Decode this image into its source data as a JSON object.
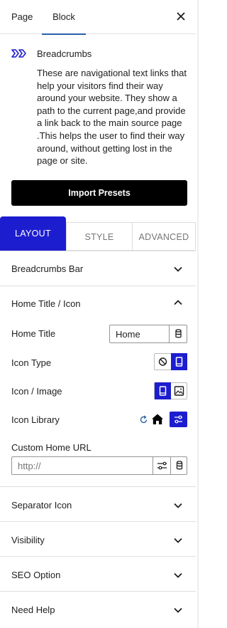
{
  "sidebar_tabs": {
    "page": "Page",
    "block": "Block"
  },
  "block": {
    "name": "Breadcrumbs",
    "description": "These are navigational text links that help your visitors find their way around your website. They show a path to the current page,and provide a link back to the main source page .This helps the user to find their way around, without getting lost in the page or site."
  },
  "import_button": "Import Presets",
  "settings_tabs": {
    "layout": "LAYOUT",
    "style": "STYLE",
    "advanced": "ADVANCED"
  },
  "panels": {
    "breadcrumbs_bar": "Breadcrumbs Bar",
    "home_title_icon": "Home Title / Icon",
    "separator_icon": "Separator Icon",
    "visibility": "Visibility",
    "seo_option": "SEO Option",
    "need_help": "Need Help"
  },
  "fields": {
    "home_title_label": "Home Title",
    "home_title_value": "Home",
    "icon_type_label": "Icon Type",
    "icon_image_label": "Icon / Image",
    "icon_library_label": "Icon Library",
    "custom_url_label": "Custom Home URL",
    "custom_url_placeholder": "http://"
  },
  "colors": {
    "accent": "#1d1dd0",
    "tab_underline": "#2a62a8",
    "button_bg": "#000000"
  }
}
